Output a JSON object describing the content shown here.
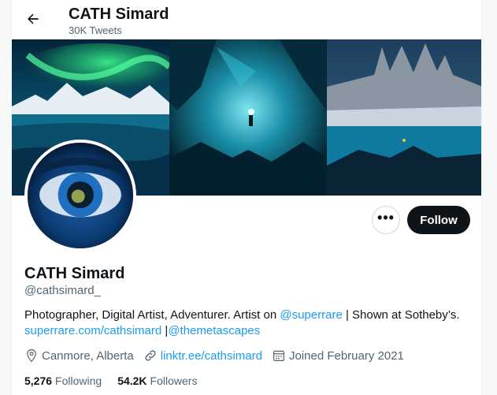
{
  "header": {
    "name": "CATH Simard",
    "tweet_count": "30K Tweets"
  },
  "profile": {
    "name": "CATH Simard",
    "handle": "@cathsimard_",
    "bio": {
      "line1_before": "Photographer, Digital Artist, Adventurer. Artist on ",
      "mention_superrare": "@superrare",
      "line1_after": " | Shown at Sotheby’s.",
      "link_superrare": "superrare.com/cathsimard",
      "separator": " |",
      "mention_metascapes": "@themetascapes"
    },
    "location": "Canmore, Alberta",
    "website": "linktr.ee/cathsimard",
    "joined": "Joined February 2021",
    "following_count": "5,276",
    "following_label": "Following",
    "followers_count": "54.2K",
    "followers_label": "Followers"
  },
  "buttons": {
    "more_label": "•••",
    "follow_label": "Follow"
  },
  "icons": {
    "back": "arrow-left-icon",
    "location": "location-pin-icon",
    "website": "link-icon",
    "joined": "calendar-icon"
  },
  "colors": {
    "link": "#1d9bf0",
    "text": "#0f1419",
    "secondary": "#536471",
    "follow_bg": "#0f1419"
  }
}
